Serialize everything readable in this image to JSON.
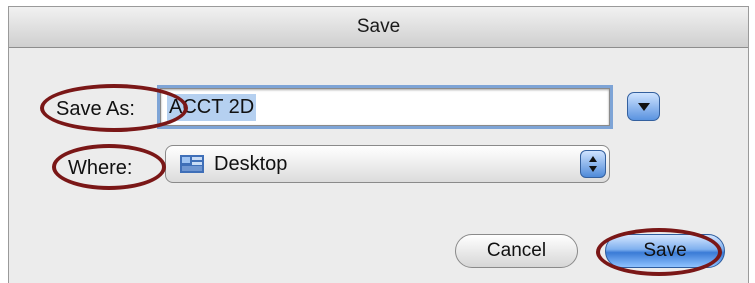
{
  "dialog": {
    "title": "Save",
    "save_as_label": "Save As:",
    "file_name": "ACCT 2D",
    "where_label": "Where:",
    "location": "Desktop",
    "cancel_label": "Cancel",
    "save_label": "Save"
  },
  "colors": {
    "annotation_ring": "#7a1717",
    "default_button": "#3a7bd6",
    "selection": "#b5d0f0"
  },
  "icons": {
    "expand": "chevron-down-icon",
    "popup": "up-down-arrows-icon",
    "location": "desktop-folder-icon"
  }
}
